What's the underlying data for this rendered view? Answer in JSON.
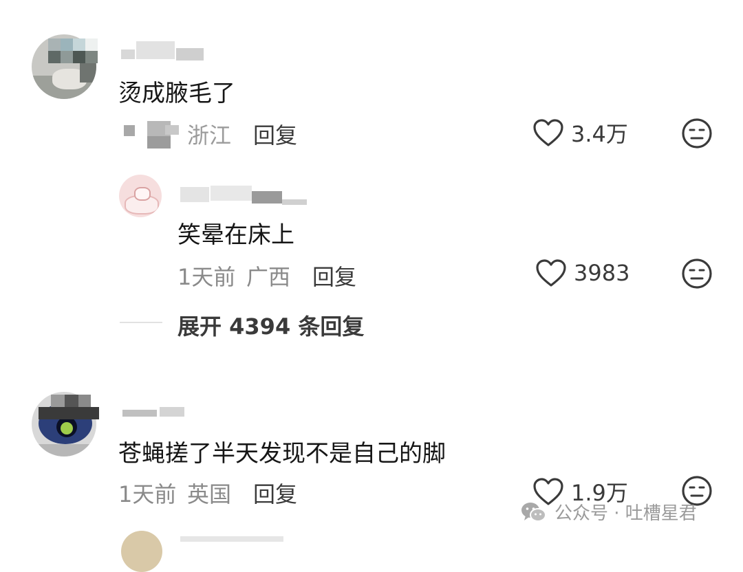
{
  "comments": [
    {
      "text": "烫成腋毛了",
      "location": "浙江",
      "reply_label": "回复",
      "likes": "3.4万",
      "replies": [
        {
          "text": "笑晕在床上",
          "time": "1天前",
          "location": "广西",
          "reply_label": "回复",
          "likes": "3983"
        }
      ],
      "expand_label": "展开 4394 条回复"
    },
    {
      "text": "苍蝇搓了半天发现不是自己的脚",
      "time": "1天前",
      "location": "英国",
      "reply_label": "回复",
      "likes": "1.9万"
    }
  ],
  "watermark": {
    "text": "公众号 · 吐槽星君",
    "icon": "wechat-icon"
  },
  "colors": {
    "text": "#161616",
    "meta": "#8a8a8a",
    "icon": "#3a3a3a"
  }
}
